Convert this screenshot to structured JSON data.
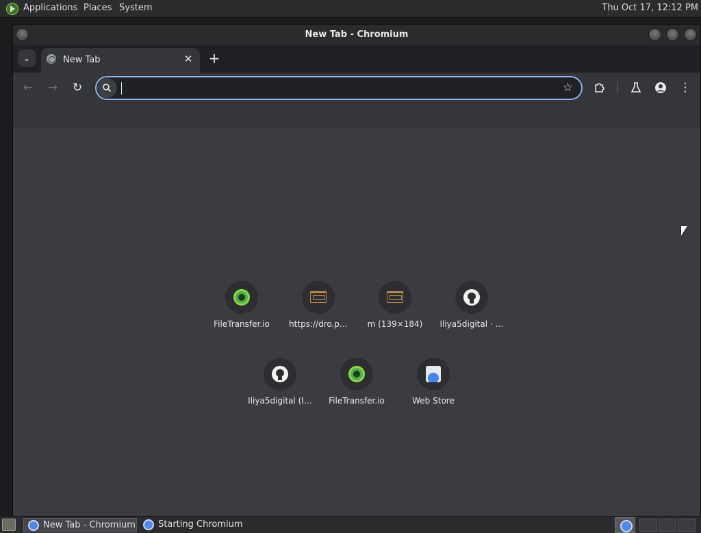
{
  "top_panel": {
    "menus": [
      "Applications",
      "Places",
      "System"
    ],
    "clock": "Thu Oct 17, 12:12 PM"
  },
  "window": {
    "title": "New Tab - Chromium"
  },
  "tabs": [
    {
      "title": "New Tab",
      "active": true
    }
  ],
  "toolbar": {
    "omnibox_value": ""
  },
  "new_tab_page": {
    "shortcuts": [
      {
        "label": "FileTransfer.io",
        "icon": "filetransfer-icon"
      },
      {
        "label": "https://dro.p…",
        "icon": "dro-site-icon"
      },
      {
        "label": "m (139×184)",
        "icon": "dro-site-icon"
      },
      {
        "label": "Iliya5digital · …",
        "icon": "github-icon"
      },
      {
        "label": "Iliya5digital (I…",
        "icon": "github-icon"
      },
      {
        "label": "FileTransfer.io",
        "icon": "filetransfer-icon"
      },
      {
        "label": "Web Store",
        "icon": "web-store-icon"
      }
    ]
  },
  "taskbar": {
    "tasks": [
      {
        "label": "New Tab - Chromium",
        "active": true
      },
      {
        "label": "Starting Chromium",
        "active": false
      }
    ]
  },
  "colors": {
    "accent_focus": "#8ab4f8",
    "tab_strip": "#202124",
    "toolbar": "#35363a",
    "ntp_background": "#3b3c41"
  }
}
